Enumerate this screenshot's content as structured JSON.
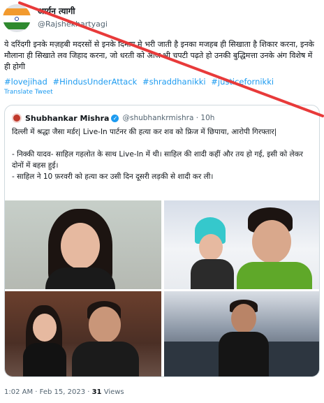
{
  "tweet": {
    "author": {
      "display_name": "आर्यन त्यागी",
      "handle": "@Rajshekhartyagi"
    },
    "body": "ये दरिंदगी इनके मज़हबी मदरसों से इनके दिमाग मे भरी जाती है इनका मजहब ही सिखाता है शिकार करना, इनके मौलाना ही सिखाते लव जिहाद करना, जो धरती को आज भी चपटी पढ़ते हो उनकी बुद्धिमत्ता उनके अंग विशेष में ही होगी",
    "hashtags": [
      "#lovejihad",
      "#HindusUnderAttack",
      "#shraddhanikki",
      "#justicefornikki"
    ],
    "translate_label": "Translate Tweet",
    "footer": {
      "timestamp": "1:02 AM · Feb 15, 2023 · ",
      "views_count": "31",
      "views_label": " Views"
    }
  },
  "quoted_tweet": {
    "author": {
      "display_name": "Shubhankar Mishra",
      "handle": "@shubhankrmishra · 10h"
    },
    "lines": [
      "दिल्ली में श्रद्धा जैसा मर्डर| Live-In पार्टनर की हत्या कर शव को फ्रिज में छिपाया, आरोपी गिरफ्तार|",
      "",
      "- निक्की यादव- साहिल गहलोत के साथ Live-In में थी। साहिल की शादी कहीं और तय हो गई, इसी को लेकर दोनों में बहस हुई।",
      "- साहिल ने 10 फ़रवरी को हत्या कर उसी दिन दूसरी लड़की से शादी कर ली।"
    ]
  },
  "colors": {
    "link": "#1d9bf0",
    "strike": "#e83a3a",
    "border": "#cfd9de"
  }
}
